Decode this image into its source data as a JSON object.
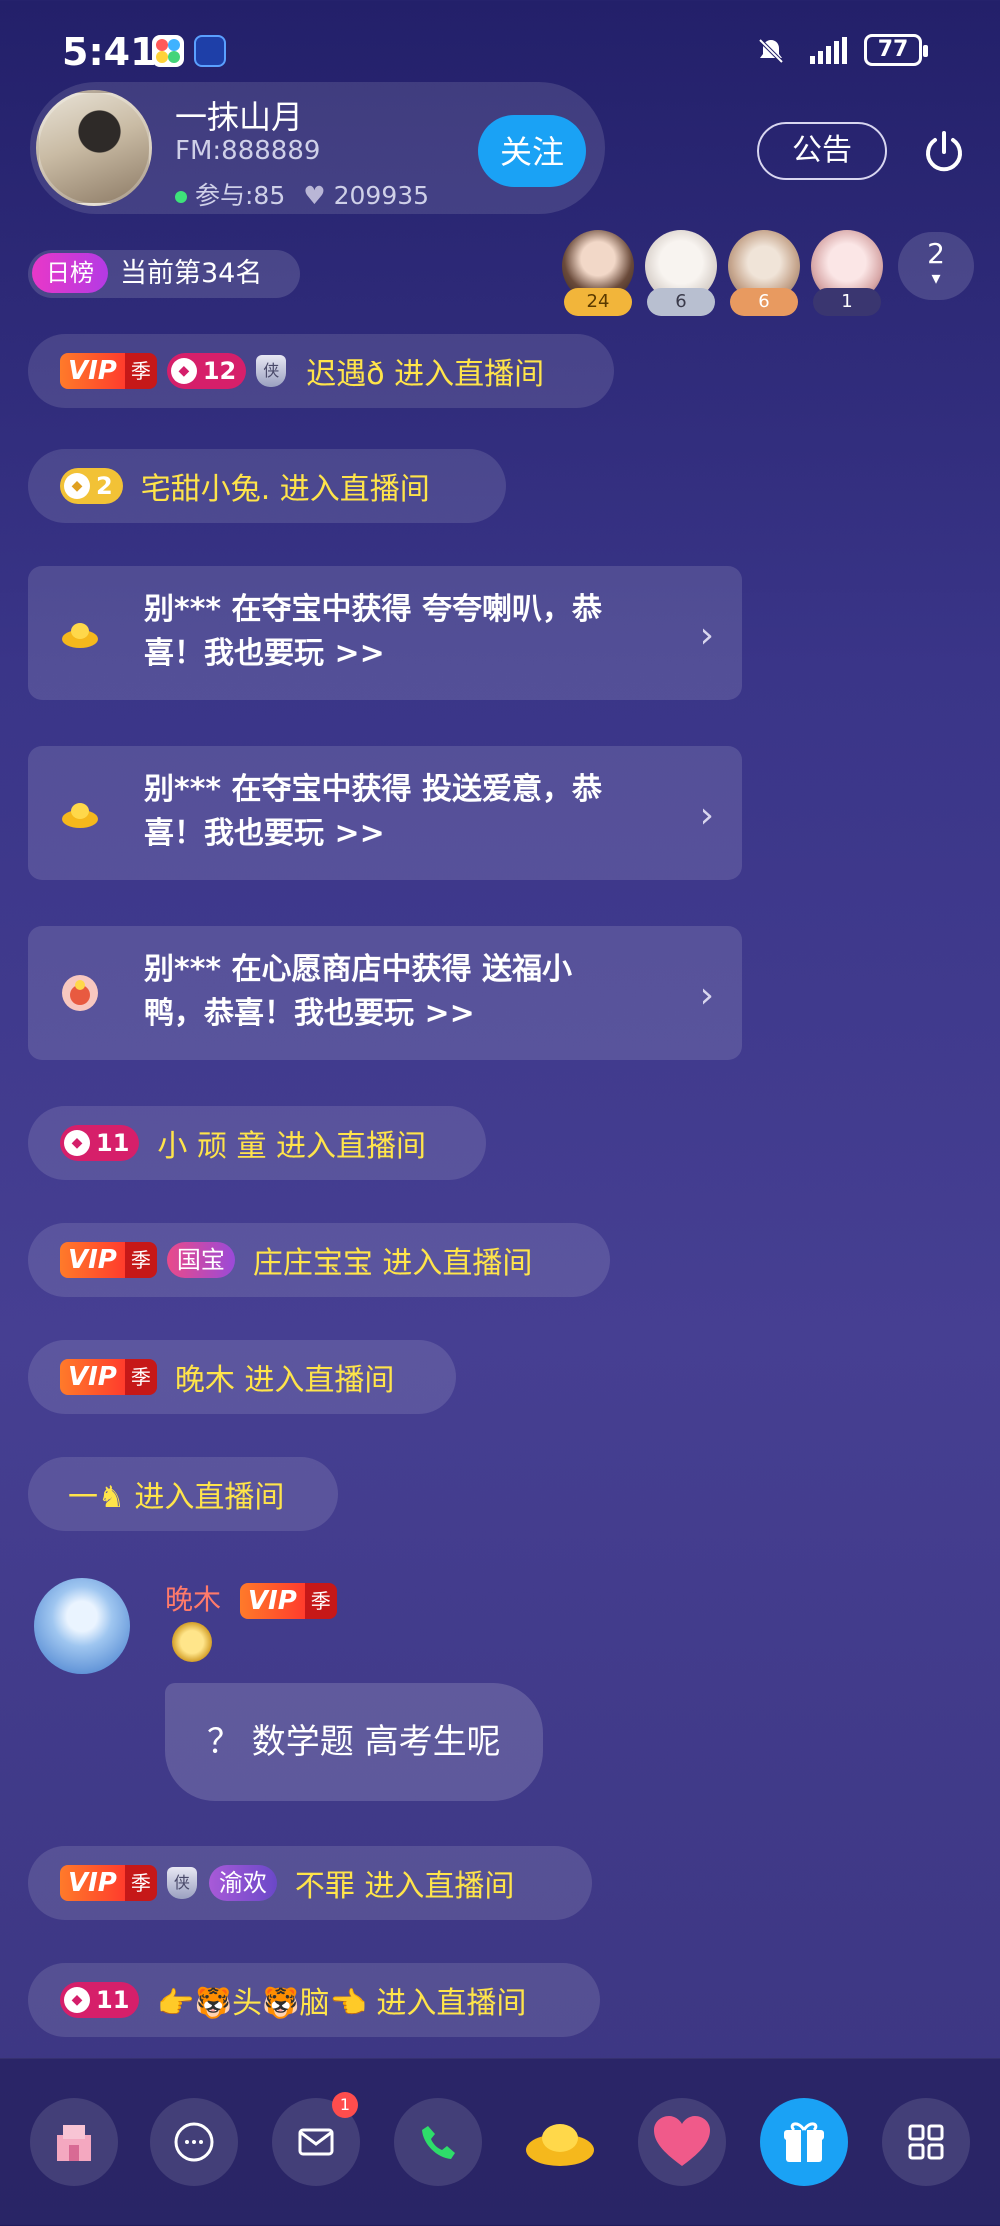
{
  "status": {
    "time": "5:41",
    "battery": "77"
  },
  "host": {
    "name": "一抹山月",
    "fm": "FM:888889",
    "participants": "参与:85",
    "likes": "209935",
    "follow_label": "关注"
  },
  "header": {
    "notice_label": "公告"
  },
  "rank": {
    "tag": "日榜",
    "text": "当前第34名"
  },
  "top_users": [
    {
      "count": "24"
    },
    {
      "count": "6"
    },
    {
      "count": "6"
    },
    {
      "count": "1"
    }
  ],
  "more_count": "2",
  "messages": {
    "m1": {
      "level": "12",
      "text": "迟遇ð 进入直播间"
    },
    "m2": {
      "level": "2",
      "text": "宅甜小兔. 进入直播间"
    },
    "card1": {
      "text": "别*** 在夺宝中获得 夸夸喇叭，恭喜！我也要玩 >>"
    },
    "card2": {
      "text": "别*** 在夺宝中获得 投送爱意，恭喜！我也要玩 >>"
    },
    "card3": {
      "text": "别*** 在心愿商店中获得 送福小鸭，恭喜！我也要玩 >>"
    },
    "m3": {
      "level": "11",
      "text": "小 顽 童 进入直播间"
    },
    "m4": {
      "tag": "国宝",
      "text": "庄庄宝宝 进入直播间"
    },
    "m5": {
      "text": "晚木 进入直播间"
    },
    "m6": {
      "text": "一♞ 进入直播间"
    },
    "chat": {
      "name": "晚木",
      "text": "？ 数学题 高考生呢"
    },
    "m7": {
      "tag": "渝欢",
      "text": "不罪 进入直播间"
    },
    "m8": {
      "level": "11",
      "text": "👉🐯头🐯脑👈 进入直播间"
    }
  },
  "vip": {
    "label": "VIP",
    "season": "季"
  },
  "bottom_bar": {
    "mail_badge": "1"
  },
  "colors": {
    "accent": "#1aa2f5",
    "highlight_text": "#ffe44a",
    "vip": "#ff4a2c"
  }
}
